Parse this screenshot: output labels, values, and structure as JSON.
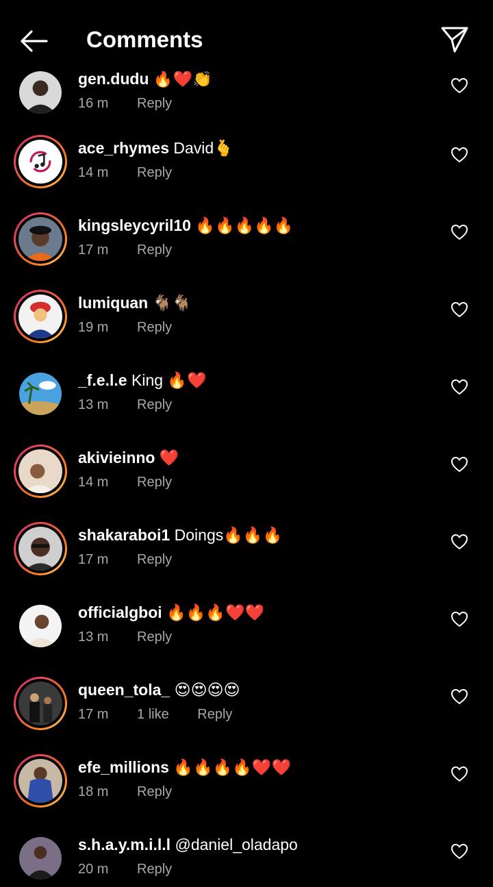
{
  "header": {
    "title": "Comments",
    "back_icon": "arrow-left-icon",
    "share_icon": "paper-plane-icon"
  },
  "colors": {
    "background": "#000000",
    "text": "#ffffff",
    "secondary_text": "#a8a8a8",
    "story_ring_start": "#d62976",
    "story_ring_end": "#feda75"
  },
  "comments": [
    {
      "username": "gen.dudu",
      "text": "🔥❤️👏",
      "time": "16 m",
      "likes": "",
      "reply": "Reply"
    },
    {
      "username": "ace_rhymes",
      "text": "David🫰",
      "time": "14 m",
      "likes": "",
      "reply": "Reply"
    },
    {
      "username": "kingsleycyril10",
      "text": "🔥🔥🔥🔥🔥",
      "time": "17 m",
      "likes": "",
      "reply": "Reply"
    },
    {
      "username": "lumiquan",
      "text": "🐐🐐",
      "time": "19 m",
      "likes": "",
      "reply": "Reply"
    },
    {
      "username": "_f.e.l.e",
      "text": "King 🔥❤️",
      "time": "13 m",
      "likes": "",
      "reply": "Reply"
    },
    {
      "username": "akivieinno",
      "text": "❤️",
      "time": "14 m",
      "likes": "",
      "reply": "Reply"
    },
    {
      "username": "shakaraboi1",
      "text": "Doings🔥🔥🔥",
      "time": "17 m",
      "likes": "",
      "reply": "Reply"
    },
    {
      "username": "officialgboi",
      "text": "🔥🔥🔥❤️❤️",
      "time": "13 m",
      "likes": "",
      "reply": "Reply"
    },
    {
      "username": "queen_tola_",
      "text": "😍😍😍😍",
      "time": "17 m",
      "likes": "1 like",
      "reply": "Reply"
    },
    {
      "username": "efe_millions",
      "text": "🔥🔥🔥🔥❤️❤️",
      "time": "18 m",
      "likes": "",
      "reply": "Reply"
    },
    {
      "username": "s.h.a.y.m.i.l.l",
      "text": "@daniel_oladapo",
      "time": "20 m",
      "likes": "",
      "reply": "Reply"
    }
  ]
}
